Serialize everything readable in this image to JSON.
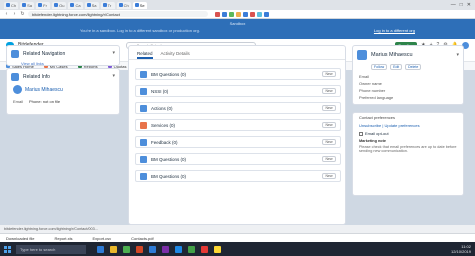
{
  "browser": {
    "tabs": [
      {
        "label": "Ch",
        "active": false
      },
      {
        "label": "Sa",
        "active": false
      },
      {
        "label": "Fr",
        "active": false
      },
      {
        "label": "Ou",
        "active": false
      },
      {
        "label": "Ca",
        "active": false
      },
      {
        "label": "Sa",
        "active": false
      },
      {
        "label": "Tr",
        "active": false
      },
      {
        "label": "Ch",
        "active": false
      },
      {
        "label": "Se",
        "active": true
      }
    ],
    "url": "bitdefender.lightning.force.com/lightning/r/Contact",
    "win_min": "—",
    "win_max": "□",
    "win_close": "✕"
  },
  "banner": {
    "label": "Sandbox",
    "notice": "You're in a sandbox. Log in to a different sandbox or production org.",
    "link": "Log in to a different org"
  },
  "header": {
    "app_name": "Bitdefender",
    "search_placeholder": "Search Salesforce",
    "badge": "Sandbox"
  },
  "nav": {
    "tabs": [
      {
        "label": "Lead Home"
      },
      {
        "label": "Marius Mihaescu",
        "active": true
      }
    ]
  },
  "utility": {
    "items": [
      "Sales Home",
      "My Cases",
      "Reports",
      "Quotas",
      "Knowledge"
    ]
  },
  "left": {
    "related_title": "Related Navigation",
    "related_sub": "View all links",
    "account_label": "Related Info",
    "contact_name": "Marius Mihaescu",
    "field_label": "Email",
    "field_value": "Phone: not on file"
  },
  "center": {
    "tab_active": "Related",
    "tab_inactive": "Activity Details",
    "items": [
      {
        "label": "BM Questions (0)",
        "color": "#4d8edb",
        "btn": "New"
      },
      {
        "label": "NSSI (0)",
        "color": "#4d8edb",
        "btn": "New"
      },
      {
        "label": "Actions (0)",
        "color": "#4d8edb",
        "btn": "New"
      },
      {
        "label": "Services (0)",
        "color": "#e8734a",
        "btn": "New"
      },
      {
        "label": "Feedback (0)",
        "color": "#4d8edb",
        "btn": "New"
      },
      {
        "label": "BM Questions (0)",
        "color": "#4d8edb",
        "btn": "New"
      },
      {
        "label": "BM Questions (0)",
        "color": "#4d8edb",
        "btn": "New"
      }
    ]
  },
  "right": {
    "record_title": "Marius Mihaescu",
    "actions": [
      "Follow",
      "Edit",
      "Delete"
    ],
    "fields": [
      "Email",
      "Owner name",
      "Phone number",
      "Preferred language"
    ],
    "panel2_title": "Contact preferences",
    "panel2_links": [
      "Unsubscribe  |  Update preferences"
    ],
    "check_label": "Email opt-out",
    "note_title": "Marketing note",
    "note": "Please check that email preferences are up to date before sending new communication."
  },
  "statusbar": {
    "text": "bitdefender.lightning.force.com/lightning/r/Contact/003..."
  },
  "downloads": [
    "Downloaded file",
    "Report.xls",
    "Export.csv",
    "Contacts.pdf"
  ],
  "taskbar": {
    "search": "Type here to search",
    "time": "11:02",
    "date": "12/10/2019"
  }
}
